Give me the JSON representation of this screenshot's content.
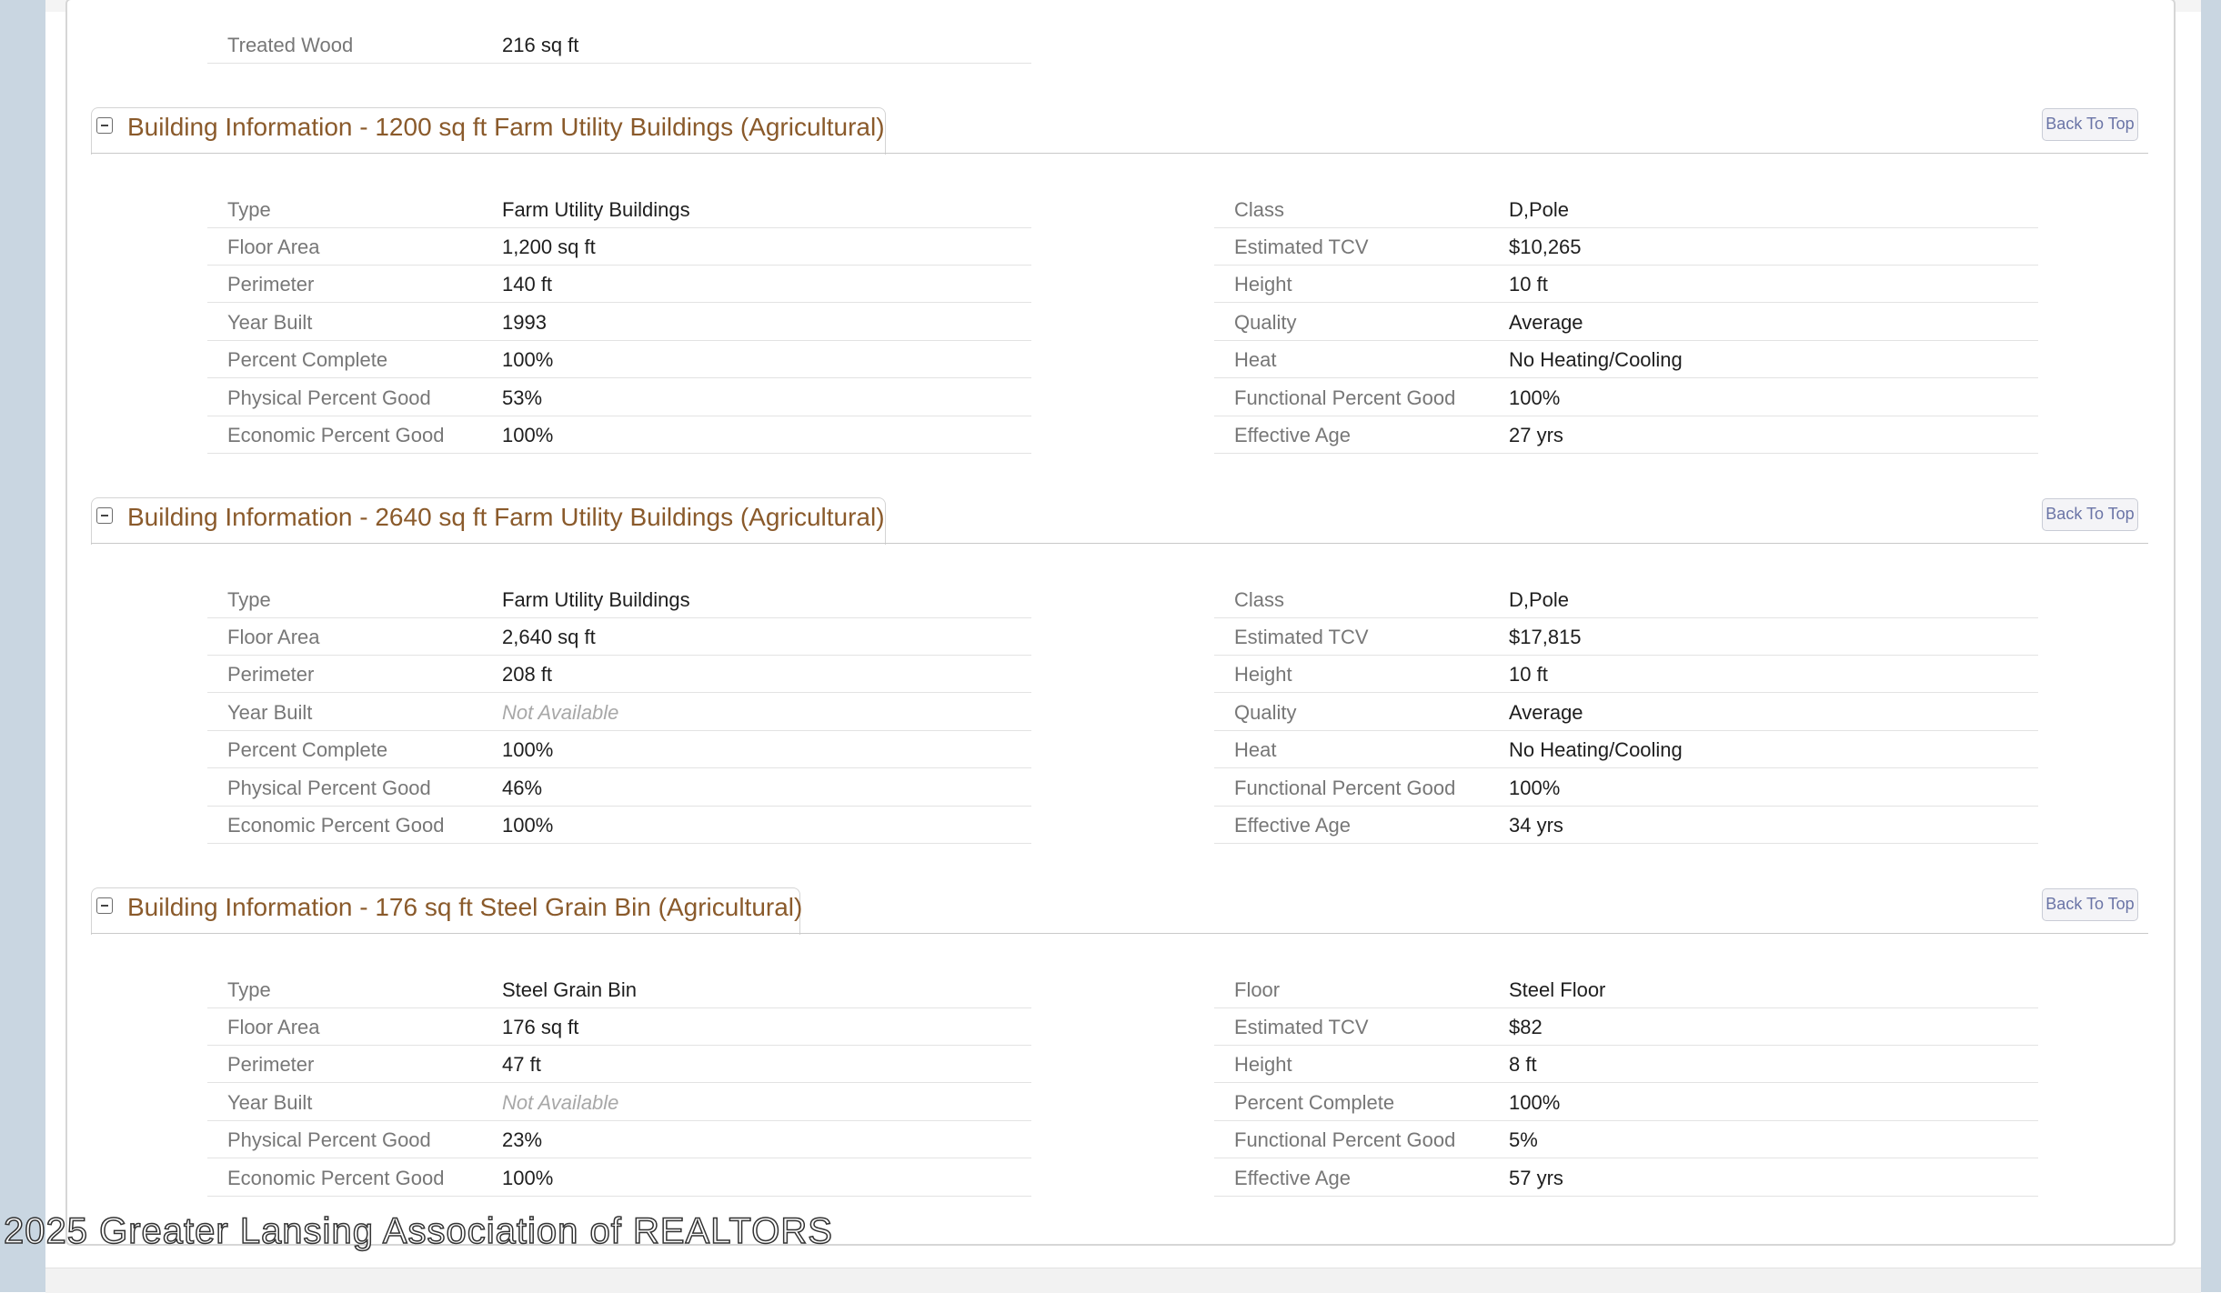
{
  "top_row": {
    "label": "Treated Wood",
    "value": "216 sq ft"
  },
  "sections": [
    {
      "title": "Building Information - 1200 sq ft Farm Utility Buildings (Agricultural)",
      "back_label": "Back To Top",
      "left": [
        {
          "label": "Type",
          "value": "Farm Utility Buildings"
        },
        {
          "label": "Floor Area",
          "value": "1,200 sq ft"
        },
        {
          "label": "Perimeter",
          "value": "140 ft"
        },
        {
          "label": "Year Built",
          "value": "1993"
        },
        {
          "label": "Percent Complete",
          "value": "100%"
        },
        {
          "label": "Physical Percent Good",
          "value": "53%"
        },
        {
          "label": "Economic Percent Good",
          "value": "100%"
        }
      ],
      "right": [
        {
          "label": "Class",
          "value": "D,Pole"
        },
        {
          "label": "Estimated TCV",
          "value": "$10,265"
        },
        {
          "label": "Height",
          "value": "10 ft"
        },
        {
          "label": "Quality",
          "value": "Average"
        },
        {
          "label": "Heat",
          "value": "No Heating/Cooling"
        },
        {
          "label": "Functional Percent Good",
          "value": "100%"
        },
        {
          "label": "Effective Age",
          "value": "27 yrs"
        }
      ]
    },
    {
      "title": "Building Information - 2640 sq ft Farm Utility Buildings (Agricultural)",
      "back_label": "Back To Top",
      "left": [
        {
          "label": "Type",
          "value": "Farm Utility Buildings"
        },
        {
          "label": "Floor Area",
          "value": "2,640 sq ft"
        },
        {
          "label": "Perimeter",
          "value": "208 ft"
        },
        {
          "label": "Year Built",
          "value": "Not Available"
        },
        {
          "label": "Percent Complete",
          "value": "100%"
        },
        {
          "label": "Physical Percent Good",
          "value": "46%"
        },
        {
          "label": "Economic Percent Good",
          "value": "100%"
        }
      ],
      "right": [
        {
          "label": "Class",
          "value": "D,Pole"
        },
        {
          "label": "Estimated TCV",
          "value": "$17,815"
        },
        {
          "label": "Height",
          "value": "10 ft"
        },
        {
          "label": "Quality",
          "value": "Average"
        },
        {
          "label": "Heat",
          "value": "No Heating/Cooling"
        },
        {
          "label": "Functional Percent Good",
          "value": "100%"
        },
        {
          "label": "Effective Age",
          "value": "34 yrs"
        }
      ]
    },
    {
      "title": "Building Information - 176 sq ft Steel Grain Bin (Agricultural)",
      "back_label": "Back To Top",
      "left": [
        {
          "label": "Type",
          "value": "Steel Grain Bin"
        },
        {
          "label": "Floor Area",
          "value": "176 sq ft"
        },
        {
          "label": "Perimeter",
          "value": "47 ft"
        },
        {
          "label": "Year Built",
          "value": "Not Available"
        },
        {
          "label": "Physical Percent Good",
          "value": "23%"
        },
        {
          "label": "Economic Percent Good",
          "value": "100%"
        }
      ],
      "right": [
        {
          "label": "Floor",
          "value": "Steel Floor"
        },
        {
          "label": "Estimated TCV",
          "value": "$82"
        },
        {
          "label": "Height",
          "value": "8 ft"
        },
        {
          "label": "Percent Complete",
          "value": "100%"
        },
        {
          "label": "Functional Percent Good",
          "value": "5%"
        },
        {
          "label": "Effective Age",
          "value": "57 yrs"
        }
      ]
    }
  ],
  "footer": "2025 Greater Lansing Association of REALTORS",
  "colors": {
    "section_title": "#8a5a2b",
    "label_text": "#777777",
    "not_available": "#a8a8a8",
    "side_strip": "#c9d6e1",
    "back_button_text": "#6a74a6"
  }
}
